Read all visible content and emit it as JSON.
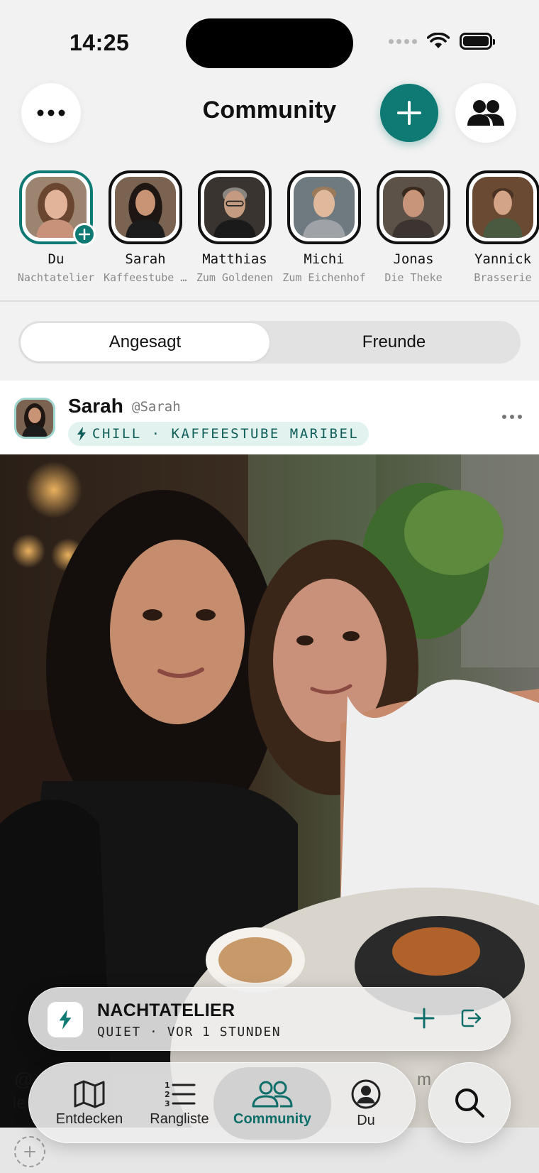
{
  "status_bar": {
    "time": "14:25"
  },
  "header": {
    "title": "Community"
  },
  "stories": [
    {
      "name": "Du",
      "place": "Nachtatelier",
      "self": true
    },
    {
      "name": "Sarah",
      "place": "Kaffeestube Maribel"
    },
    {
      "name": "Matthias",
      "place": "Zum Goldenen"
    },
    {
      "name": "Michi",
      "place": "Zum Eichenhof"
    },
    {
      "name": "Jonas",
      "place": "Die Theke"
    },
    {
      "name": "Yannick",
      "place": "Brasserie"
    }
  ],
  "segments": {
    "trending": "Angesagt",
    "friends": "Freunde",
    "selected": "Angesagt"
  },
  "post": {
    "author": "Sarah",
    "handle": "@Sarah",
    "tag": "CHILL · KAFFEESTUBE MARIBEL",
    "caption_start": "@",
    "caption_line2": "le",
    "caption_right": "m"
  },
  "current_place": {
    "name": "NACHTATELIER",
    "status": "QUIET · VOR 1 STUNDEN"
  },
  "tabs": {
    "discover": "Entdecken",
    "leaderboard": "Rangliste",
    "community": "Community",
    "me": "Du",
    "active": "Community"
  },
  "colors": {
    "accent": "#0f7a74"
  }
}
